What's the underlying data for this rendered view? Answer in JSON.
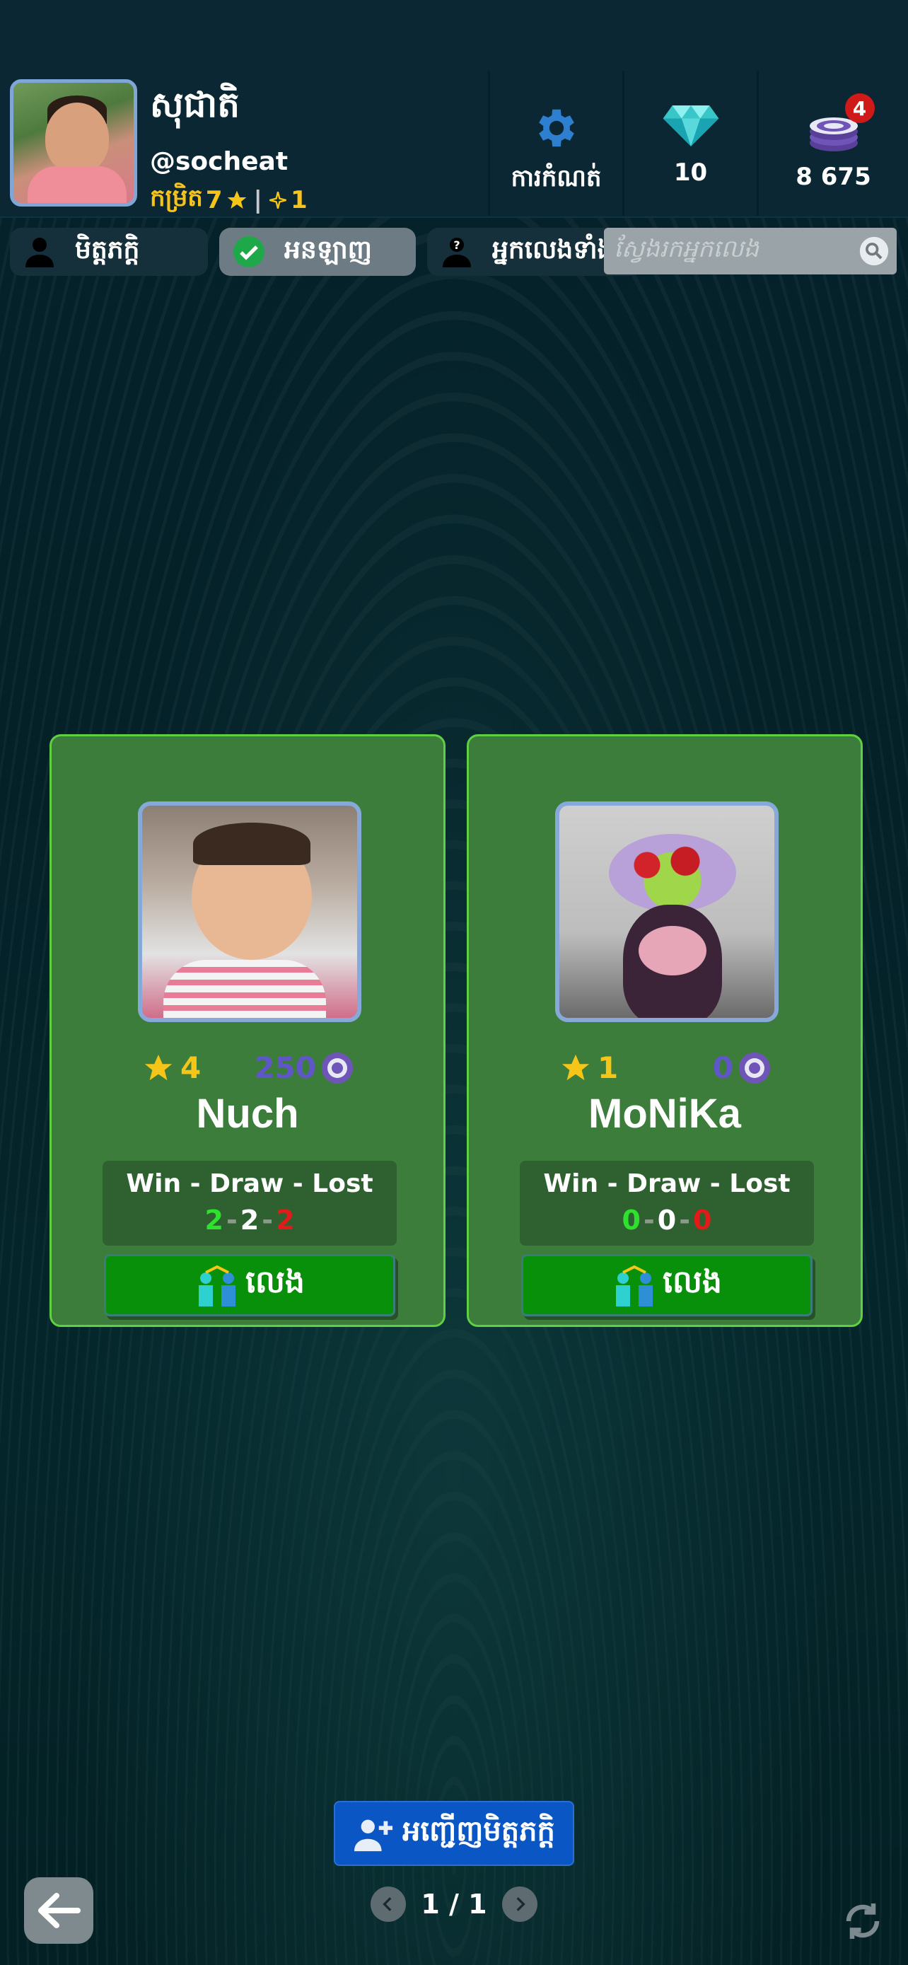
{
  "profile": {
    "name": "សុជាតិ",
    "handle": "@socheat",
    "rank_label": "កម្រិត",
    "rank_value": "7",
    "rank_extra": "1"
  },
  "header": {
    "settings_label": "ការកំណត់",
    "diamonds": "10",
    "chips": "8 675",
    "notification_count": "4"
  },
  "tabs": [
    {
      "label": "មិត្តភក្តិ",
      "icon": "person-icon",
      "active": false
    },
    {
      "label": "អនឡាញ",
      "icon": "check-circle-icon",
      "active": true
    },
    {
      "label": "អ្នកលេងទាំង",
      "icon": "person-question-icon",
      "active": false
    }
  ],
  "search": {
    "placeholder": "ស្វែងរកអ្នកលេង"
  },
  "players": [
    {
      "name": "Nuch",
      "stars": "4",
      "chips": "250",
      "wdl_title": "Win - Draw - Lost",
      "win": "2",
      "draw": "2",
      "lost": "2",
      "play_label": "លេង"
    },
    {
      "name": "MoNiKa",
      "stars": "1",
      "chips": "0",
      "wdl_title": "Win - Draw - Lost",
      "win": "0",
      "draw": "0",
      "lost": "0",
      "play_label": "លេង"
    }
  ],
  "invite_label": "អញ្ជើញមិត្តភក្តិ",
  "pagination": {
    "text": "1 / 1"
  },
  "colors": {
    "accent_green": "#08900a",
    "card_border": "#5fd043",
    "invite_blue": "#0a56c4",
    "gold": "#f5c518"
  }
}
